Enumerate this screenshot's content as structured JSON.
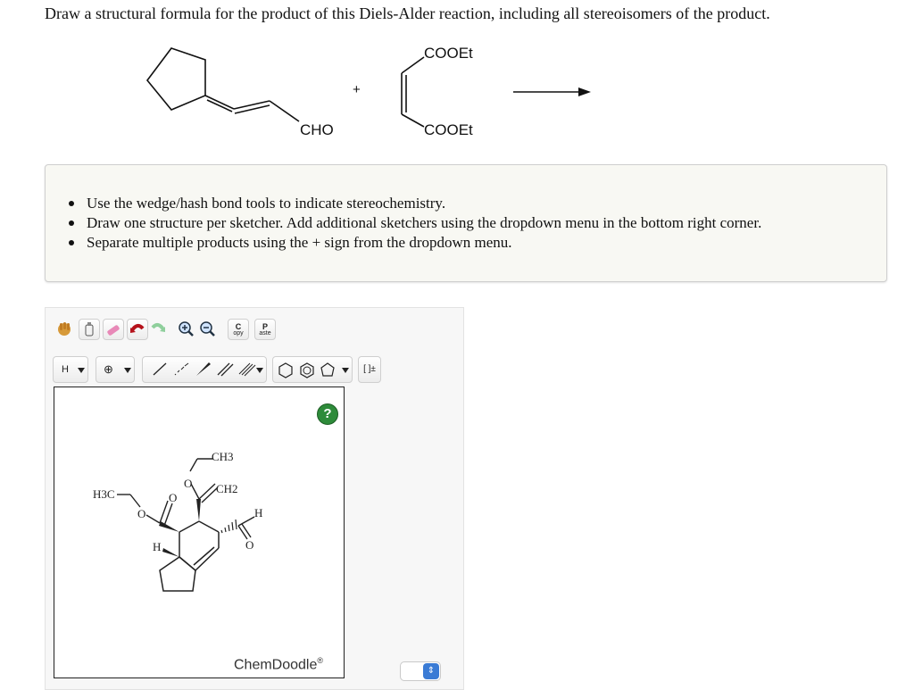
{
  "question": "Draw a structural formula for the product of this Diels-Alder reaction, including all stereoisomers of the product.",
  "reaction": {
    "diene_label": "CHO",
    "dienophile_top": "COOEt",
    "dienophile_bottom": "COOEt",
    "plus": "+"
  },
  "instructions": [
    "Use the wedge/hash bond tools to indicate stereochemistry.",
    "Draw one structure per sketcher. Add additional sketchers using the dropdown menu in the bottom right corner.",
    "Separate multiple products using the + sign from the dropdown menu."
  ],
  "toolbar": {
    "copy_label_top": "C",
    "copy_label_bottom": "opy",
    "paste_label_top": "P",
    "paste_label_bottom": "aste",
    "element_label": "H",
    "charge_label": "⊕",
    "bracket_label": "[ ]±"
  },
  "sketcher": {
    "help_label": "?",
    "brand": "ChemDoodle",
    "brand_mark": "®"
  },
  "molecule": {
    "ch3": "CH3",
    "o_top": "O",
    "ch2": "CH2",
    "h3c": "H3C",
    "o_left": "O",
    "o_carbonyl": "O",
    "h_right": "H",
    "o_aldehyde": "O",
    "h_left": "H"
  },
  "colors": {
    "help_green": "#2e8b3a",
    "spinner_blue": "#3a7bd5",
    "panel_bg": "#f8f8f3"
  }
}
